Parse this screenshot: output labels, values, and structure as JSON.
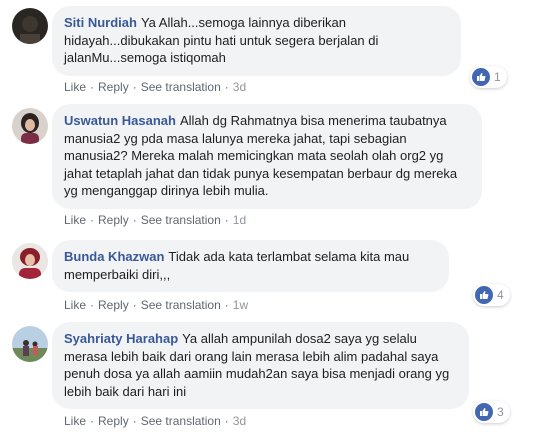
{
  "actions": {
    "like": "Like",
    "reply": "Reply",
    "see_translation": "See translation",
    "separator": "·"
  },
  "comments": [
    {
      "author": "Siti Nurdiah",
      "text": "Ya Allah...semoga lainnya diberikan hidayah...dibukakan pintu hati untuk segera berjalan di jalanMu...semoga istiqomah",
      "time": "3d",
      "reactions": "1",
      "reaction_icon": "like-icon"
    },
    {
      "author": "Uswatun Hasanah",
      "text": "Allah dg Rahmatnya bisa menerima taubatnya manusia2 yg pda masa lalunya mereka jahat, tapi sebagian manusia2? Mereka malah memicingkan mata seolah olah org2 yg jahat tetaplah jahat dan tidak punya kesempatan berbaur dg mereka yg menganggap dirinya lebih mulia.",
      "time": "1d"
    },
    {
      "author": "Bunda Khazwan",
      "text": "Tidak ada kata terlambat selama kita mau memperbaiki diri,,,",
      "time": "1w",
      "reactions": "4",
      "reaction_icon": "like-icon"
    },
    {
      "author": "Syahriaty Harahap",
      "text": "Ya allah ampunilah dosa2 saya yg selalu merasa lebih baik dari orang lain merasa lebih alim padahal saya penuh dosa ya allah aamiin mudah2an saya bisa menjadi orang yg lebih baik dari hari ini",
      "time": "3d",
      "reactions": "3",
      "reaction_icon": "like-icon"
    }
  ]
}
